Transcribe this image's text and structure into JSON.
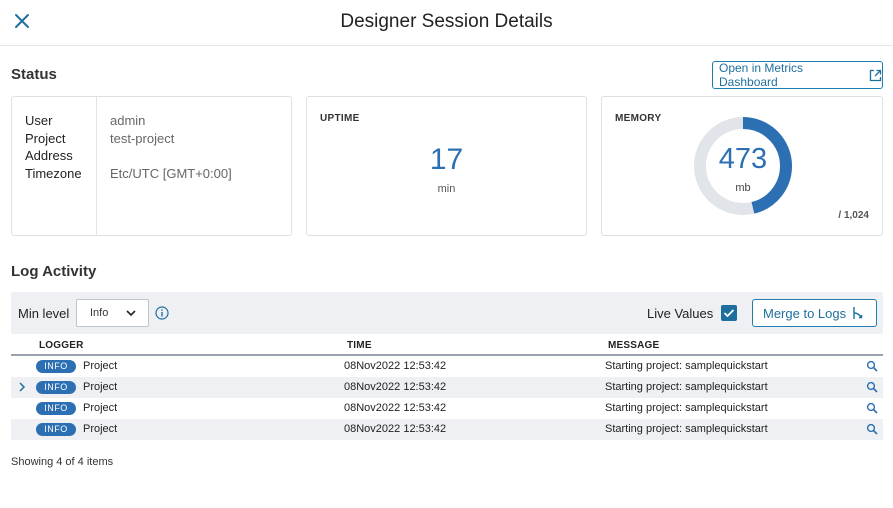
{
  "header": {
    "title": "Designer Session Details",
    "close_icon": "close-icon"
  },
  "status": {
    "section_title": "Status",
    "metrics_button": "Open in Metrics Dashboard",
    "details": {
      "keys": [
        "User",
        "Project",
        "Address",
        "Timezone"
      ],
      "values": [
        "admin",
        "test-project",
        "",
        "Etc/UTC [GMT+0:00]"
      ]
    },
    "uptime": {
      "label": "UPTIME",
      "value": "17",
      "unit": "min"
    },
    "memory": {
      "label": "MEMORY",
      "value": "473",
      "unit": "mb",
      "total": "/ 1,024",
      "fraction": 0.462
    }
  },
  "log": {
    "section_title": "Log Activity",
    "min_level_label": "Min level",
    "min_level_value": "Info",
    "live_values_label": "Live Values",
    "live_values_checked": true,
    "merge_button": "Merge to Logs",
    "columns": {
      "logger": "LOGGER",
      "time": "TIME",
      "message": "MESSAGE"
    },
    "rows": [
      {
        "level": "INFO",
        "logger": "Project",
        "time": "08Nov2022 12:53:42",
        "message": "Starting project: samplequickstart",
        "expandable": false
      },
      {
        "level": "INFO",
        "logger": "Project",
        "time": "08Nov2022 12:53:42",
        "message": "Starting project: samplequickstart",
        "expandable": true
      },
      {
        "level": "INFO",
        "logger": "Project",
        "time": "08Nov2022 12:53:42",
        "message": "Starting project: samplequickstart",
        "expandable": false
      },
      {
        "level": "INFO",
        "logger": "Project",
        "time": "08Nov2022 12:53:42",
        "message": "Starting project: samplequickstart",
        "expandable": false
      }
    ],
    "footer": "Showing 4 of 4 items"
  },
  "colors": {
    "accent": "#1f6f9e",
    "value_blue": "#2c6fb3",
    "gauge_track": "#e1e4e8",
    "toolbar_bg": "#eef0f3"
  }
}
